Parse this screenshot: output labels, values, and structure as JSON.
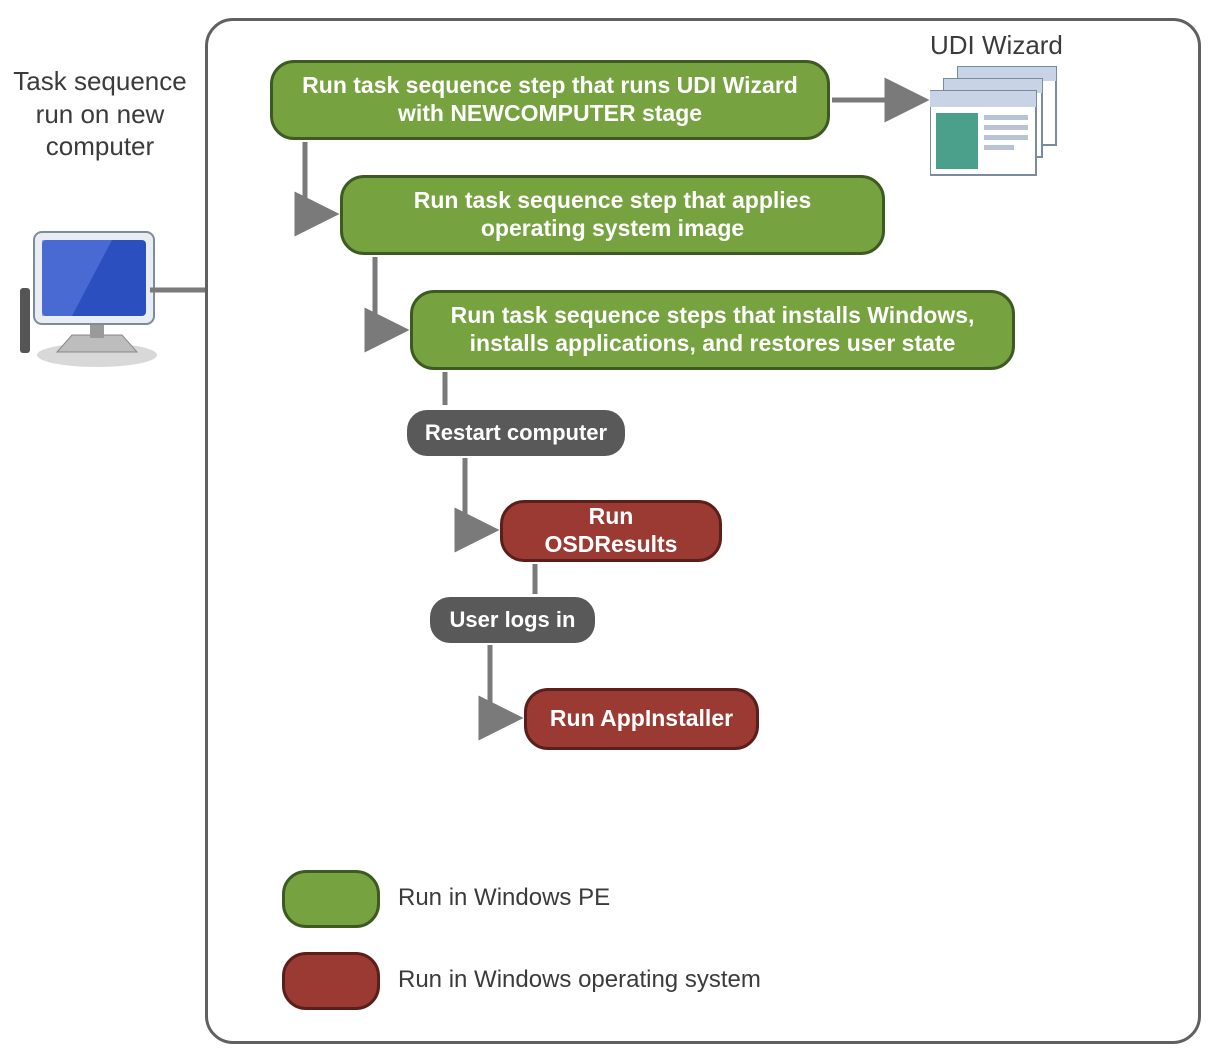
{
  "side_label": "Task sequence run on new computer",
  "top_label": "UDI Wizard",
  "nodes": {
    "step1": "Run task sequence step  that runs UDI Wizard with NEWCOMPUTER  stage",
    "step2": "Run  task sequence step that applies operating system image",
    "step3": "Run task sequence steps that installs Windows, installs applications, and restores user state",
    "restart": "Restart computer",
    "osd": "Run OSDResults",
    "login": "User logs in",
    "appinstaller": "Run AppInstaller"
  },
  "legend": {
    "pe": "Run in Windows  PE",
    "os": "Run in Windows operating system"
  }
}
